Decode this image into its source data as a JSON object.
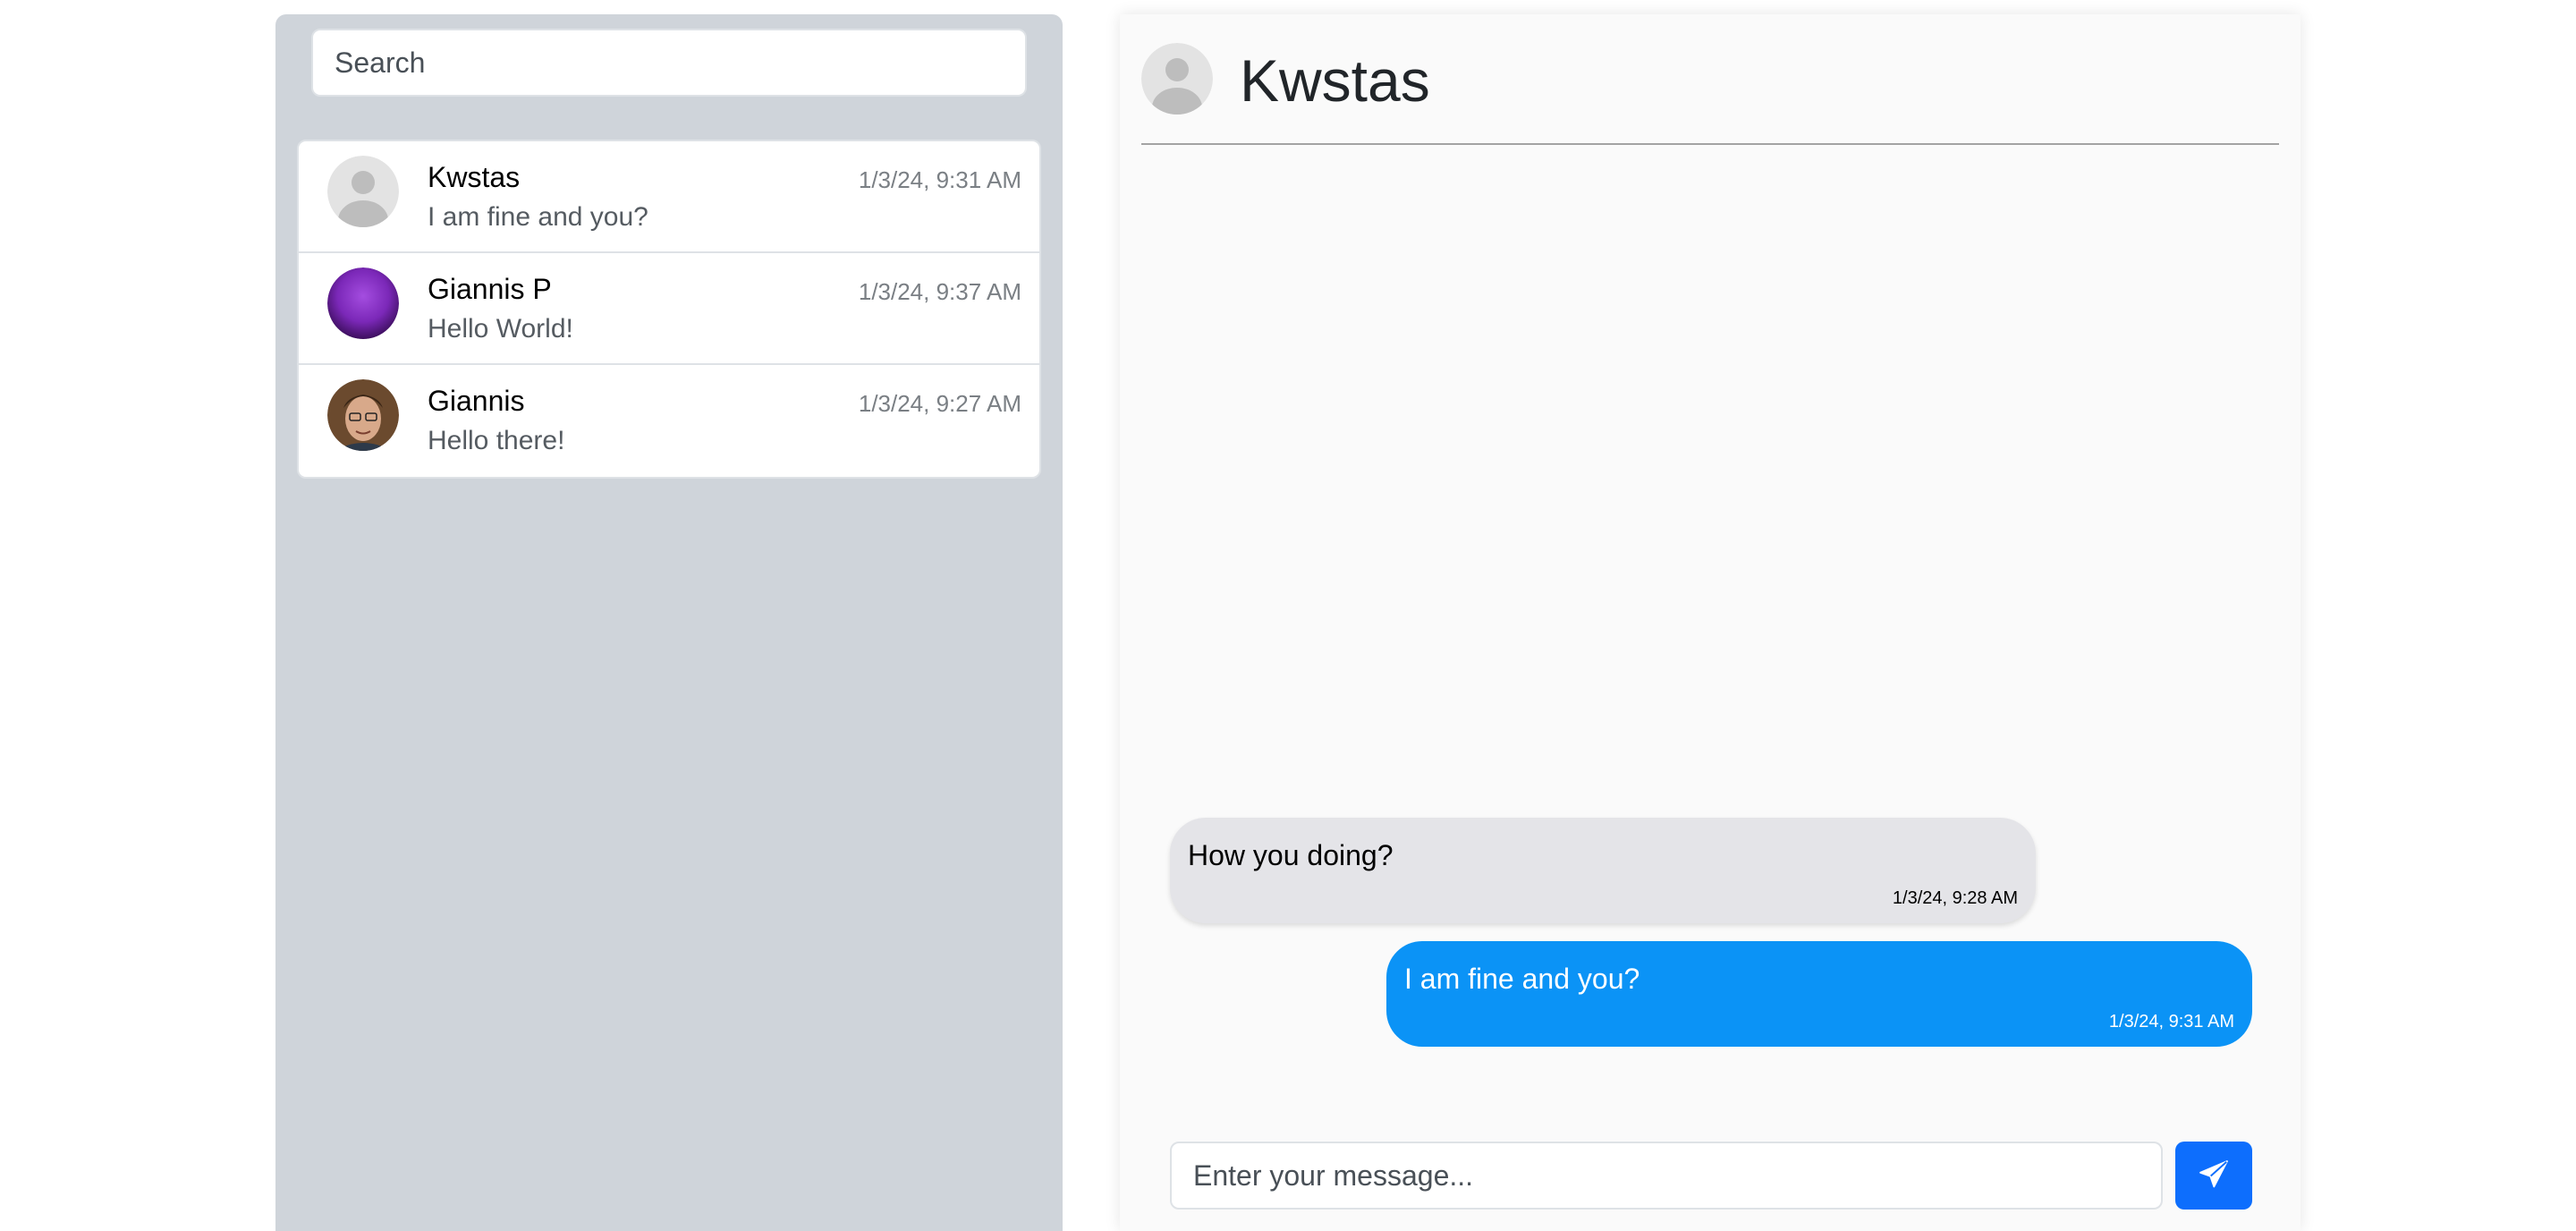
{
  "sidebar": {
    "search": {
      "placeholder": "Search",
      "value": ""
    },
    "conversations": [
      {
        "name": "Kwstas",
        "time": "1/3/24, 9:31 AM",
        "preview": "I am fine and you?",
        "avatar": "default-avatar-icon"
      },
      {
        "name": "Giannis P",
        "time": "1/3/24, 9:37 AM",
        "preview": "Hello World!",
        "avatar": "purple-avatar-image"
      },
      {
        "name": "Giannis",
        "time": "1/3/24, 9:27 AM",
        "preview": "Hello there!",
        "avatar": "photo-avatar-image"
      }
    ]
  },
  "chat": {
    "title": "Kwstas",
    "messages": [
      {
        "direction": "incoming",
        "text": "How you doing?",
        "time": "1/3/24, 9:28 AM"
      },
      {
        "direction": "outgoing",
        "text": "I am fine and you?",
        "time": "1/3/24, 9:31 AM"
      }
    ],
    "composer": {
      "placeholder": "Enter your message...",
      "value": ""
    },
    "send_icon": "paper-plane-icon"
  },
  "colors": {
    "sidebar_bg": "#cfd4da",
    "incoming_bubble": "#e4e4e8",
    "outgoing_bubble": "#0b93f6",
    "send_button": "#0d6efd"
  }
}
